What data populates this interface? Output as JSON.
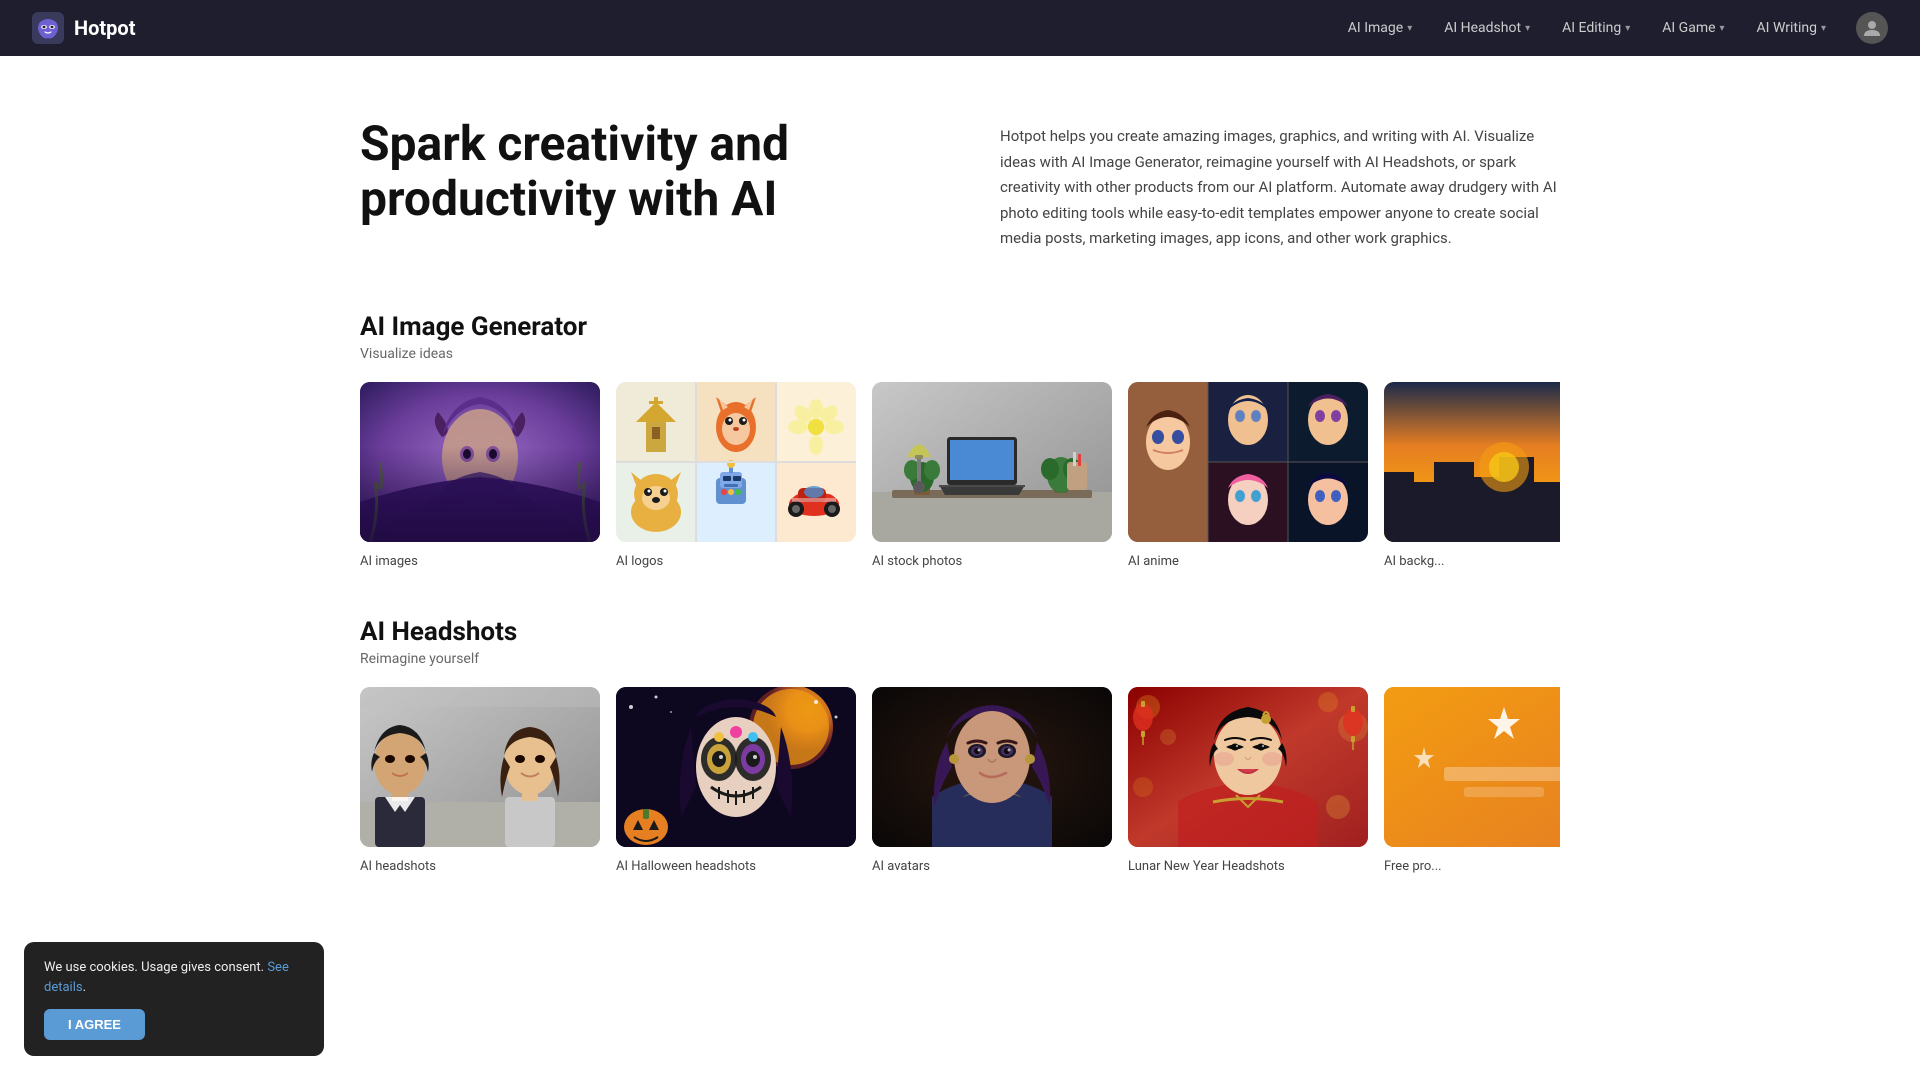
{
  "navbar": {
    "logo_text": "Hotpot",
    "items": [
      {
        "id": "ai-image",
        "label": "AI Image",
        "has_dropdown": true
      },
      {
        "id": "ai-headshot",
        "label": "AI Headshot",
        "has_dropdown": true
      },
      {
        "id": "ai-editing",
        "label": "AI Editing",
        "has_dropdown": true
      },
      {
        "id": "ai-game",
        "label": "AI Game",
        "has_dropdown": true
      },
      {
        "id": "ai-writing",
        "label": "AI Writing",
        "has_dropdown": true
      }
    ]
  },
  "hero": {
    "title": "Spark creativity and productivity with AI",
    "description": "Hotpot helps you create amazing images, graphics, and writing with AI. Visualize ideas with AI Image Generator, reimagine yourself with AI Headshots, or spark creativity with other products from our AI platform. Automate away drudgery with AI photo editing tools while easy-to-edit templates empower anyone to create social media posts, marketing images, app icons, and other work graphics."
  },
  "image_section": {
    "title": "AI Image Generator",
    "subtitle": "Visualize ideas",
    "cards": [
      {
        "id": "ai-images",
        "label": "AI images"
      },
      {
        "id": "ai-logos",
        "label": "AI logos"
      },
      {
        "id": "ai-stock-photos",
        "label": "AI stock photos"
      },
      {
        "id": "ai-anime",
        "label": "AI anime"
      },
      {
        "id": "ai-backgrounds",
        "label": "AI backg..."
      }
    ]
  },
  "headshots_section": {
    "title": "AI Headshots",
    "subtitle": "Reimagine yourself",
    "cards": [
      {
        "id": "pro-headshots",
        "label": "AI headshots"
      },
      {
        "id": "halloween-headshots",
        "label": "AI Halloween headshots"
      },
      {
        "id": "ai-avatars",
        "label": "AI avatars"
      },
      {
        "id": "lunar-headshots",
        "label": "Lunar New Year Headshots"
      },
      {
        "id": "free-pro",
        "label": "Free pro..."
      }
    ]
  },
  "cookie": {
    "message": "We use cookies. Usage gives consent.",
    "link_text": "See details",
    "button_label": "I AGREE"
  }
}
